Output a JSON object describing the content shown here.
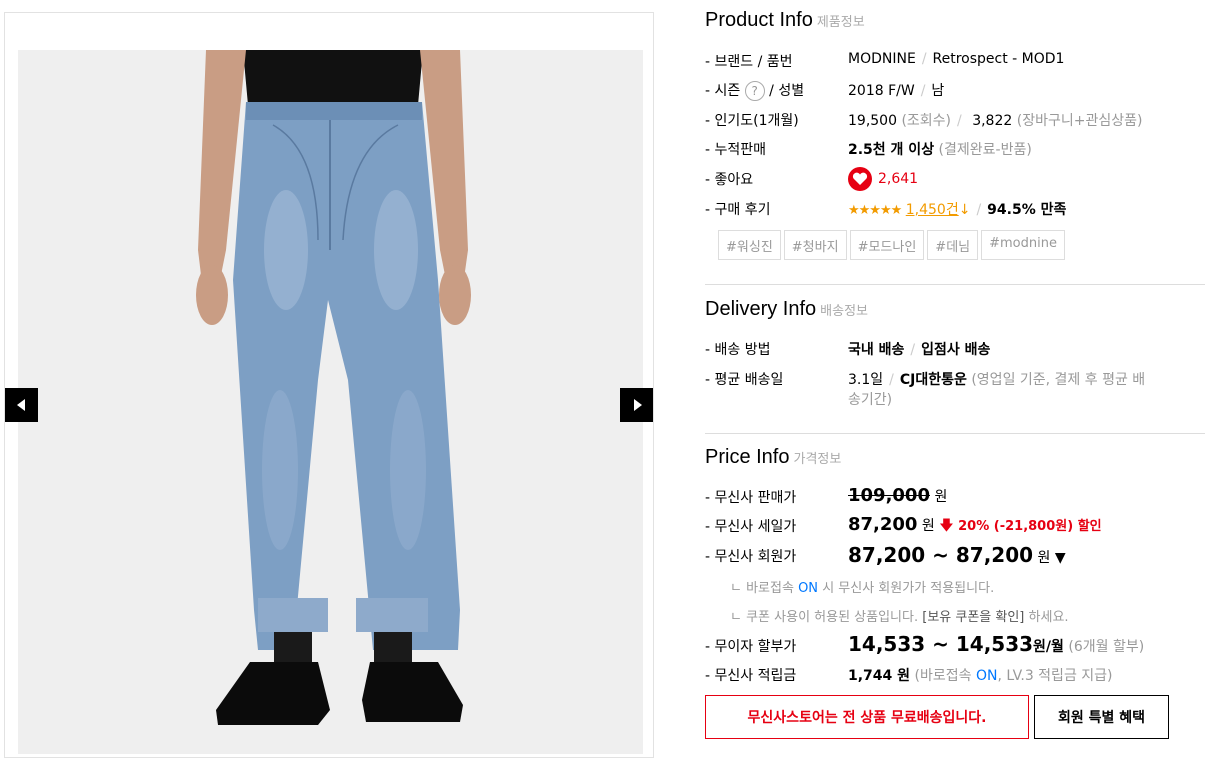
{
  "product": {
    "title_en": "Product Info",
    "title_ko": "제품정보",
    "brand_label": "- 브랜드 / 품번",
    "brand": "MODNINE",
    "sku": "Retrospect - MOD1",
    "season_label": "- 시즌",
    "season_help": "?",
    "gender_label": "/ 성별",
    "season": "2018 F/W",
    "gender": "남",
    "popularity_label": "- 인기도(1개월)",
    "views": "19,500",
    "views_note": "(조회수)",
    "carts": "3,822",
    "carts_note": "(장바구니+관심상품)",
    "sales_label": "- 누적판매",
    "sales": "2.5천 개 이상",
    "sales_note": "(결제완료-반품)",
    "likes_label": "- 좋아요",
    "likes": "2,641",
    "reviews_label": "- 구매 후기",
    "stars": "★★★★★",
    "review_count": "1,450건",
    "satisfaction": "94.5% 만족",
    "tags": [
      "#워싱진",
      "#청바지",
      "#모드나인",
      "#데님",
      "#modnine"
    ]
  },
  "delivery": {
    "title_en": "Delivery Info",
    "title_ko": "배송정보",
    "method_label": "- 배송 방법",
    "method_1": "국내 배송",
    "method_2": "입점사 배송",
    "avg_label": "- 평균 배송일",
    "avg_days": "3.1일",
    "courier": "CJ대한통운",
    "avg_note_1": "(영업일 기준, 결제 후 평균 배",
    "avg_note_2": "송기간)"
  },
  "price": {
    "title_en": "Price Info",
    "title_ko": "가격정보",
    "list_label": "- 무신사 판매가",
    "list_price": "109,000",
    "won": "원",
    "sale_label": "- 무신사 세일가",
    "sale_price": "87,200",
    "discount": "20% (-21,800원) 할인",
    "member_label": "- 무신사 회원가",
    "member_price": "87,200 ~ 87,200",
    "note_1_a": "ㄴ 바로접속",
    "note_1_on": "ON",
    "note_1_b": "시 무신사 회원가가 적용됩니다.",
    "note_2_a": "ㄴ 쿠폰 사용이 허용된 상품입니다.",
    "note_2_link": "[보유 쿠폰을 확인]",
    "note_2_b": "하세요.",
    "installment_label": "- 무이자 할부가",
    "installment": "14,533 ~ 14,533",
    "installment_unit": "원/월",
    "installment_note": "(6개월 할부)",
    "points_label": "- 무신사 적립금",
    "points": "1,744 원",
    "points_note_a": "(바로접속",
    "points_note_on": "ON",
    "points_note_b": ", LV.3 적립금 지급)",
    "free_shipping_btn": "무신사스토어는 전 상품 무료배송입니다.",
    "member_benefit_btn": "회원 특별 혜택"
  },
  "colors": {
    "accent_red": "#e60012",
    "star_orange": "#f29b00",
    "on_blue": "#0078ff"
  }
}
